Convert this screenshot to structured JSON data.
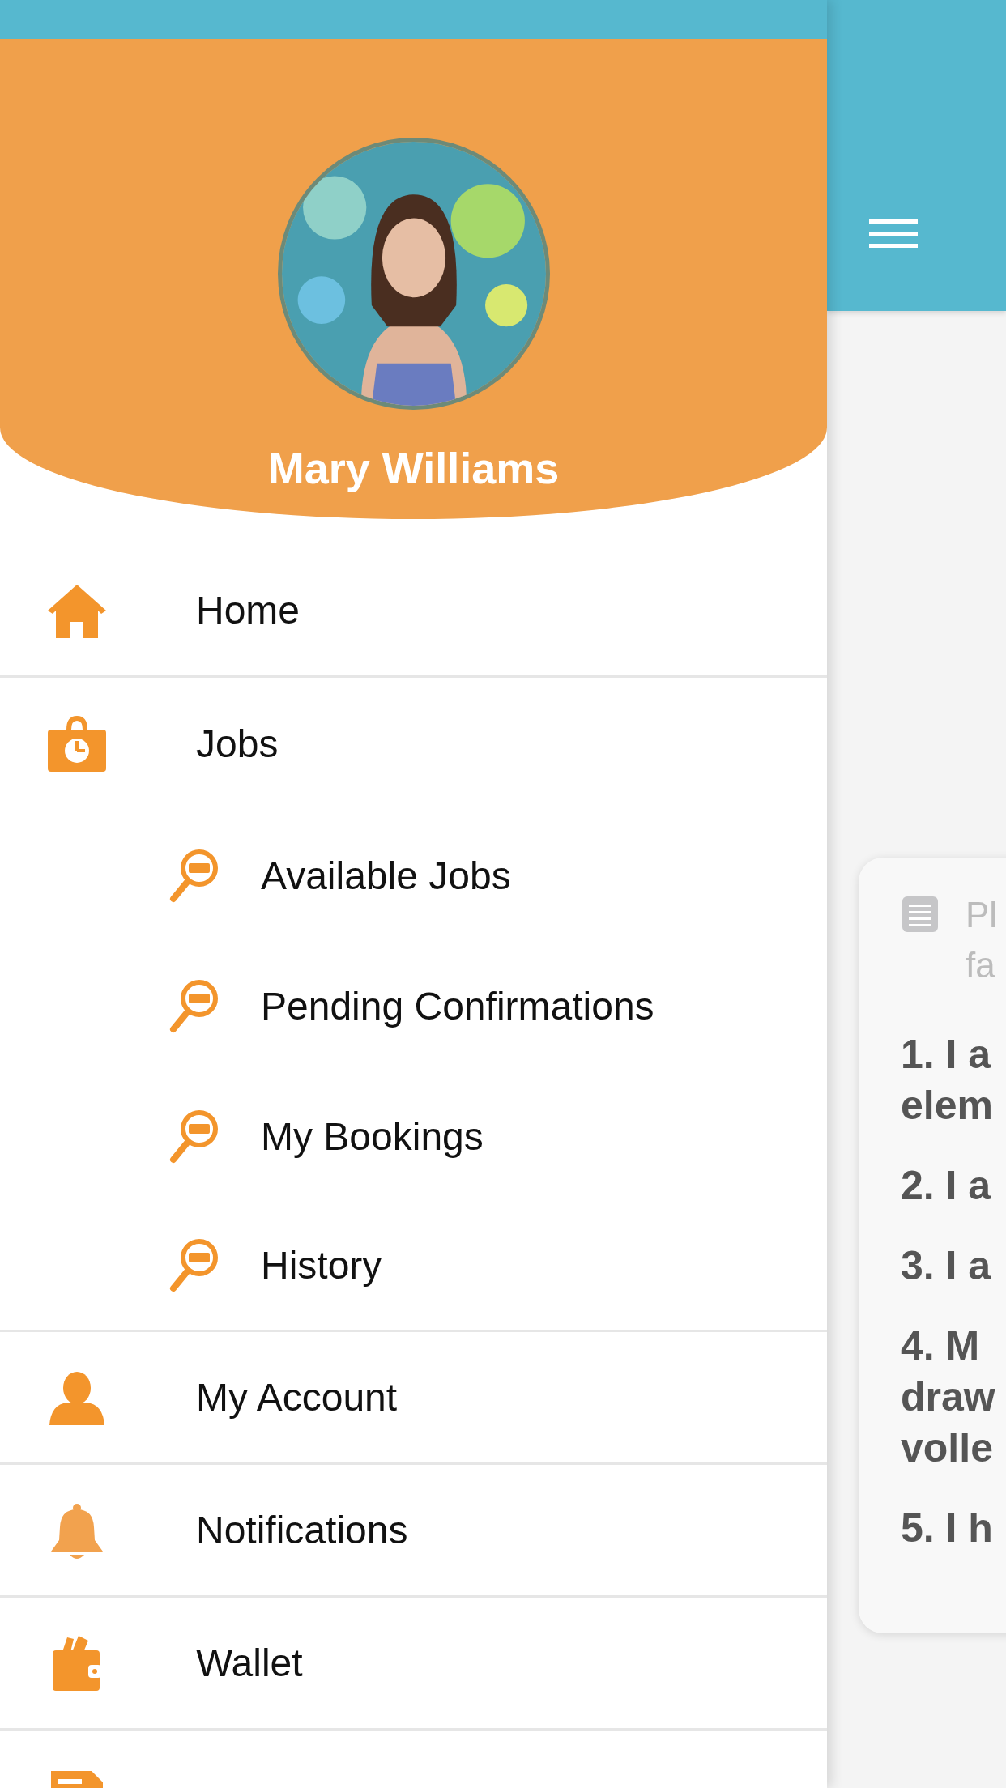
{
  "drawer": {
    "user_name": "Mary Williams",
    "menu": [
      {
        "label": "Home"
      },
      {
        "label": "Jobs",
        "children": [
          {
            "label": "Available Jobs"
          },
          {
            "label": "Pending Confirmations"
          },
          {
            "label": "My Bookings"
          },
          {
            "label": "History"
          }
        ]
      },
      {
        "label": "My Account"
      },
      {
        "label": "Notifications"
      },
      {
        "label": "Wallet"
      }
    ]
  },
  "content": {
    "card": {
      "hint_lines": [
        "Pl",
        "fa"
      ],
      "items": [
        {
          "lines": [
            "1. I a",
            "elem"
          ]
        },
        {
          "lines": [
            "2. I a"
          ]
        },
        {
          "lines": [
            "3. I a"
          ]
        },
        {
          "lines": [
            "4. M",
            "draw",
            "volle"
          ]
        },
        {
          "lines": [
            "5. I h"
          ]
        }
      ]
    }
  }
}
